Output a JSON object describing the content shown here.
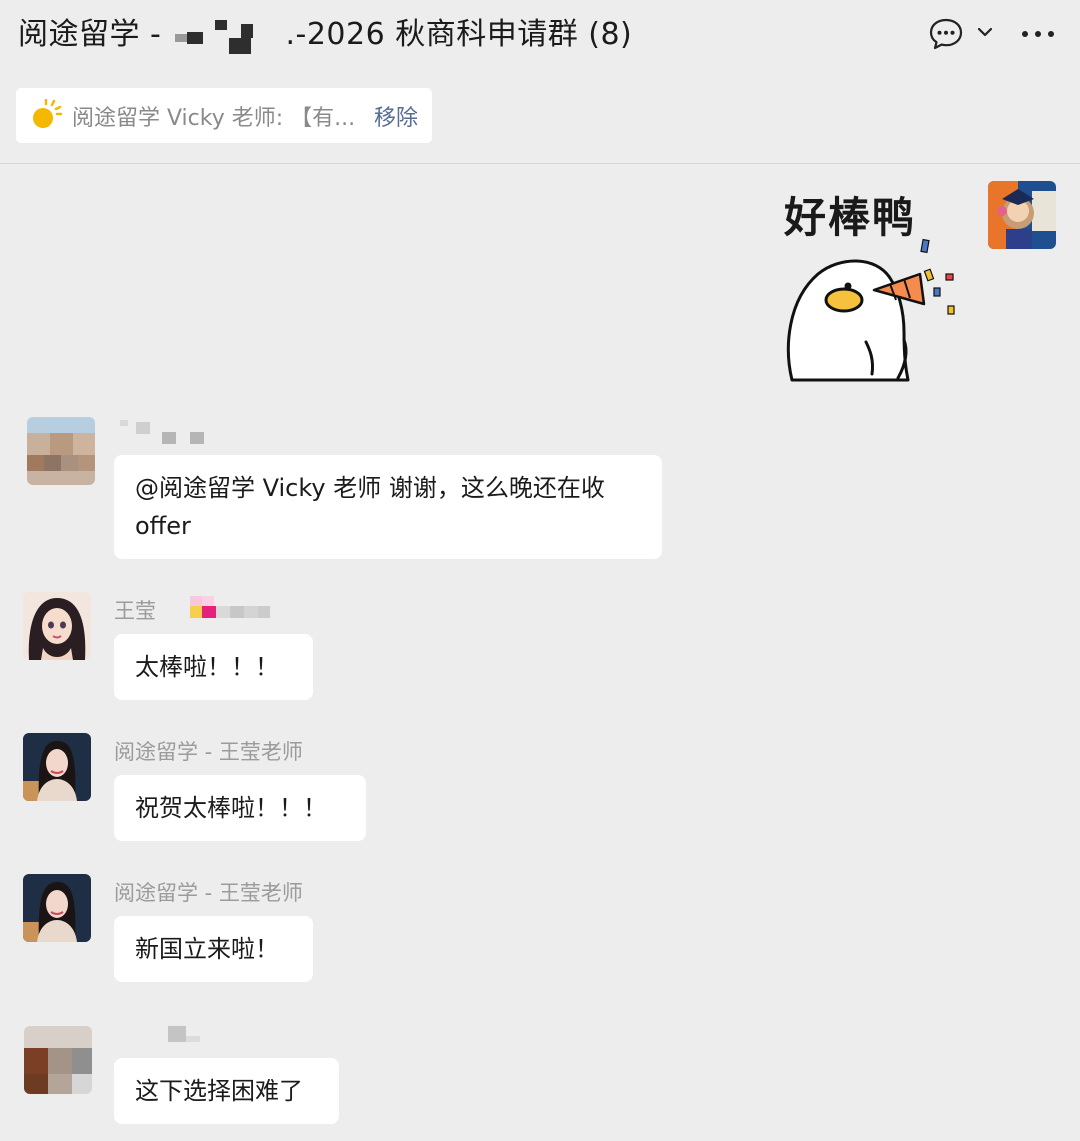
{
  "header": {
    "title_prefix": "阅途留学 -",
    "title_suffix": ".-2026 秋商科申请群 (8)"
  },
  "pinned": {
    "text": "阅途留学 Vicky 老师: 【有...",
    "remove_label": "移除"
  },
  "sticker": {
    "caption": "好棒鸭"
  },
  "messages": [
    {
      "sender": "",
      "text_line1": "@阅途留学 Vicky 老师 谢谢，这么晚还在收",
      "text_line2": "offer"
    },
    {
      "sender": "王莹",
      "text": "太棒啦！！！"
    },
    {
      "sender": "阅途留学 - 王莹老师",
      "text": "祝贺太棒啦！！！"
    },
    {
      "sender": "阅途留学 - 王莹老师",
      "text": "新国立来啦！"
    },
    {
      "sender": "",
      "text": "这下选择困难了"
    }
  ],
  "colors": {
    "background": "#ededed",
    "bubble": "#ffffff",
    "link_accent": "#576b95",
    "sender_gray": "#9b9b9b"
  },
  "icons": [
    "chat-bubble-icon",
    "chevron-down-icon",
    "more-icon",
    "sun-icon"
  ]
}
